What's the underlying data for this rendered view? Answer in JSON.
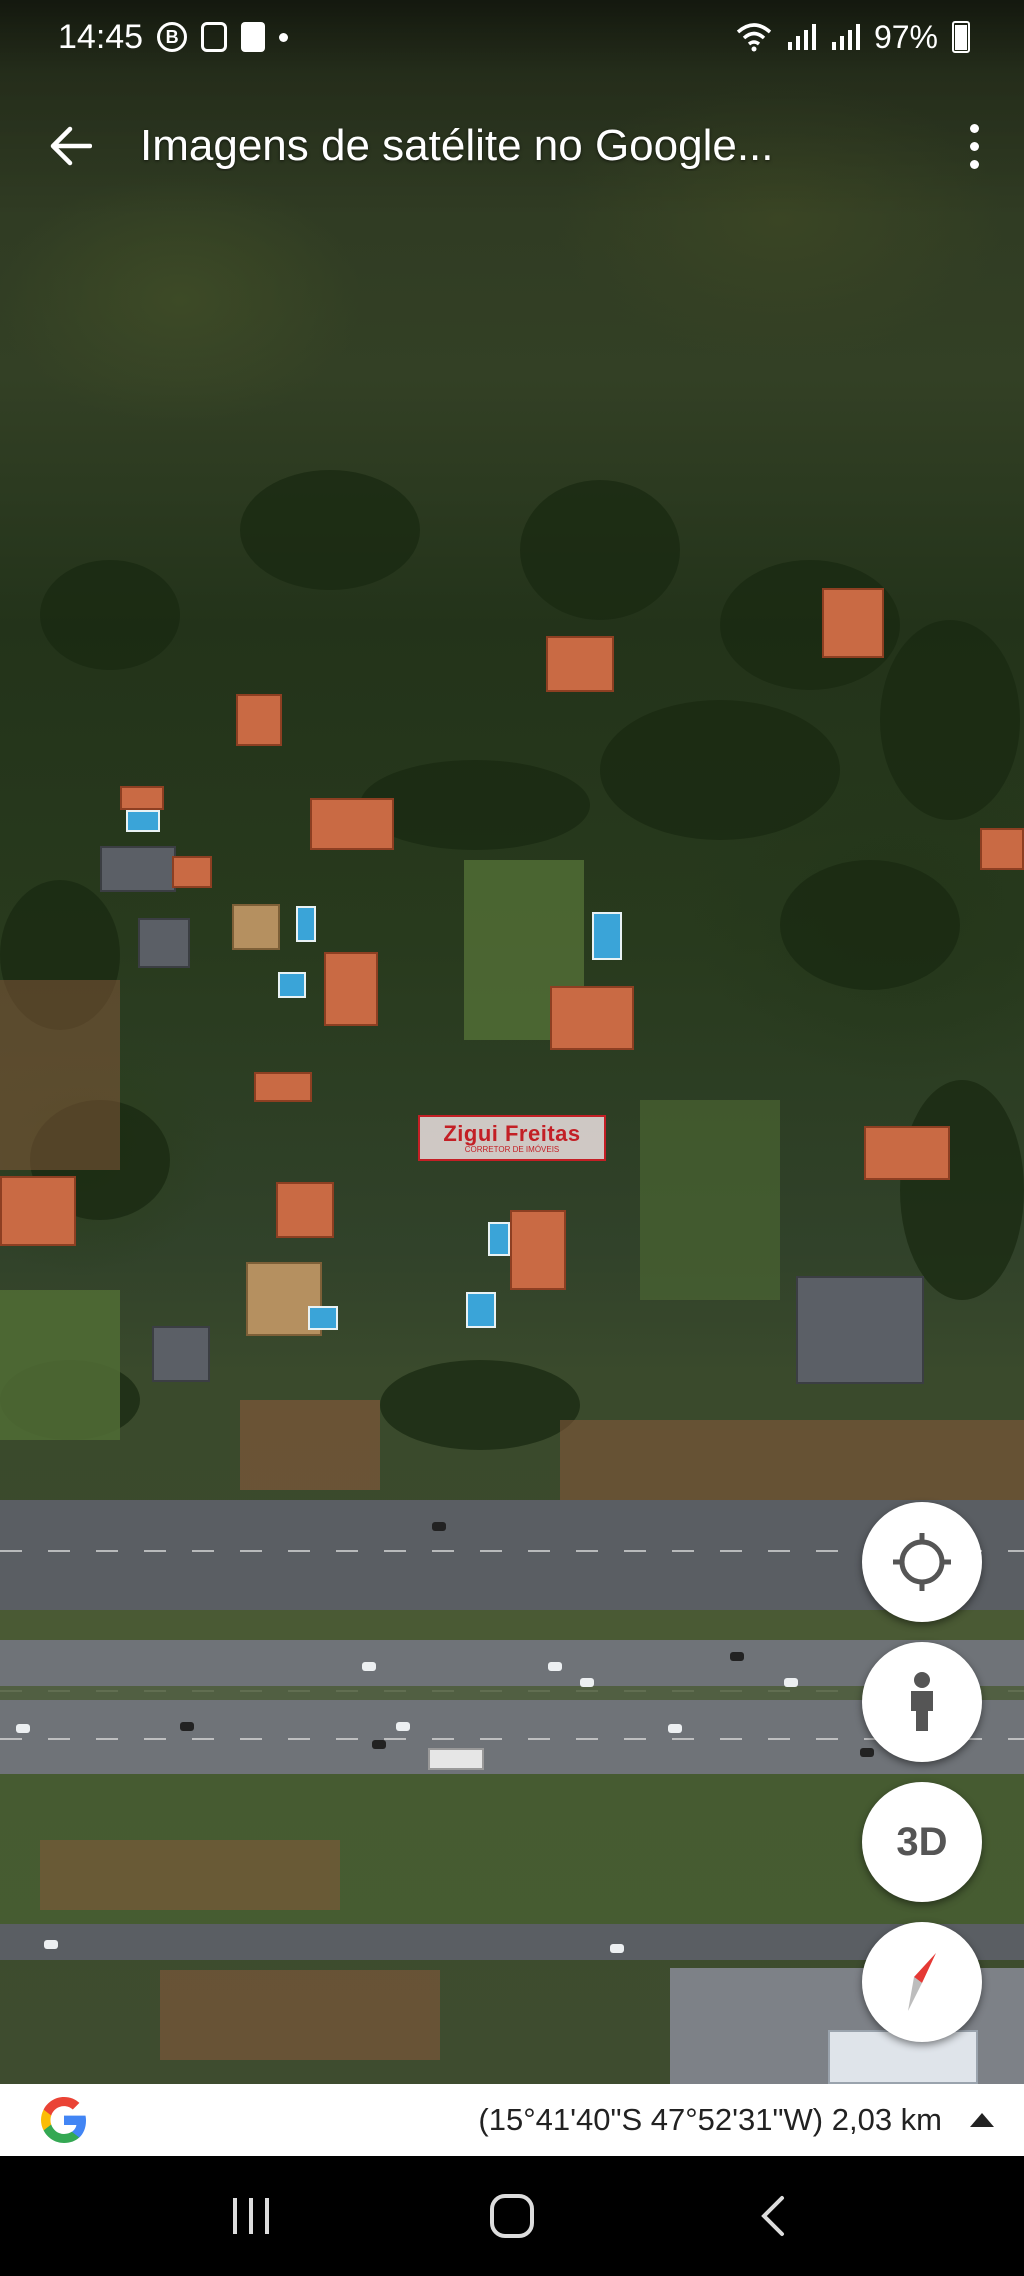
{
  "status_bar": {
    "time": "14:45",
    "battery": "97%",
    "icons": [
      "b-circle-icon",
      "square-icon",
      "document-icon",
      "dot-icon",
      "wifi-icon",
      "signal-icon",
      "signal-icon",
      "battery-icon"
    ]
  },
  "app_bar": {
    "title": "Imagens de satélite no Google...",
    "back_icon": "arrow-left-icon",
    "menu_icon": "more-vert-icon"
  },
  "map": {
    "watermark_main": "Zigui Freitas",
    "watermark_sub": "CORRETOR DE IMÓVEIS"
  },
  "map_controls": {
    "locate_icon": "crosshair-icon",
    "street_view_icon": "pegman-icon",
    "three_d_label": "3D",
    "compass_icon": "compass-icon"
  },
  "info_bar": {
    "logo": "google-g-logo",
    "coordinates": "(15°41'40\"S 47°52'31\"W) 2,03 km",
    "expand_icon": "triangle-up-icon"
  },
  "nav_bar": {
    "recents_icon": "recents-icon",
    "home_icon": "home-icon",
    "back_icon": "chevron-left-icon"
  },
  "colors": {
    "watermark_red": "#c31f25",
    "roof": "#c96a44",
    "pool": "#3aa4d8"
  }
}
